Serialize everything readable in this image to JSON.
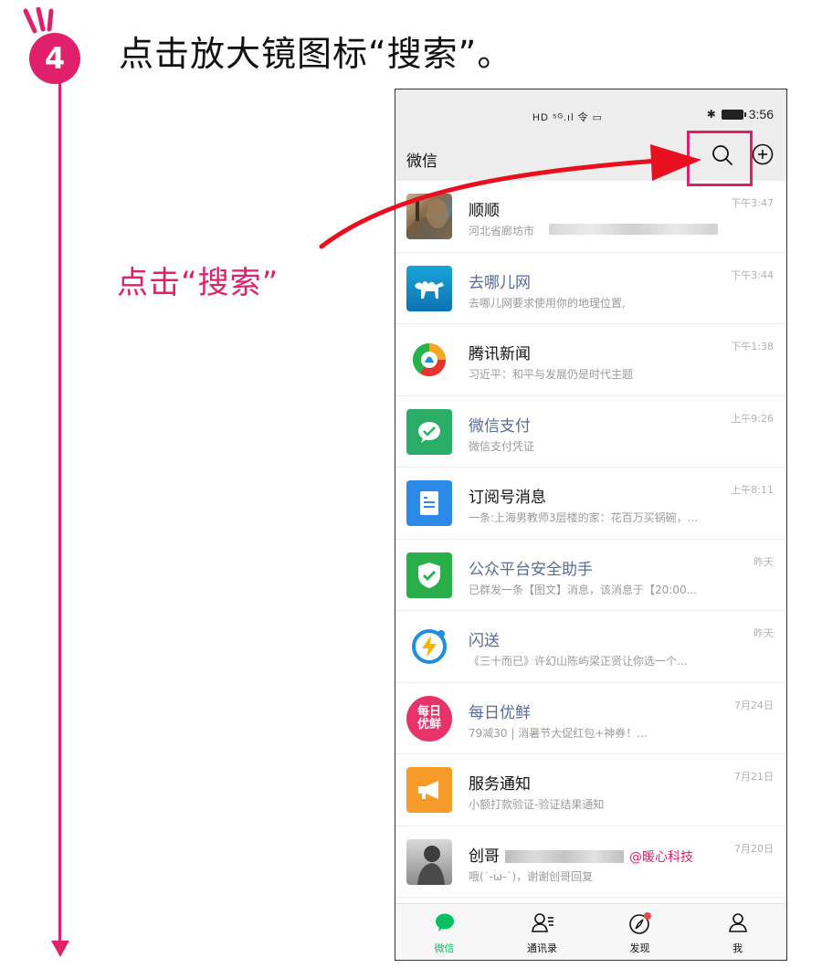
{
  "step": {
    "number": "4",
    "title": "点击放大镜图标“搜索”。",
    "callout": "点击“搜索”"
  },
  "statusbar": {
    "indicators": "HD ⁵ᴳ.ıl 令 ▭",
    "bluetooth": "✱",
    "time": "3:56"
  },
  "appbar": {
    "title": "微信",
    "search_icon": "search-icon",
    "add_icon": "plus-circle-icon"
  },
  "chats": [
    {
      "name": "顺顺",
      "preview": "河北省廊坊市",
      "time": "下午3:47",
      "link": false,
      "avatar": "photo"
    },
    {
      "name": "去哪儿网",
      "preview": "去哪儿网要求使用你的地理位置,",
      "time": "下午3:44",
      "link": true,
      "avatar": "camel"
    },
    {
      "name": "腾讯新闻",
      "preview": "习近平：和平与发展仍是时代主题",
      "time": "下午1:38",
      "link": false,
      "avatar": "news"
    },
    {
      "name": "微信支付",
      "preview": "微信支付凭证",
      "time": "上午9:26",
      "link": true,
      "avatar": "pay"
    },
    {
      "name": "订阅号消息",
      "preview": "一条:上海男教师3层楼的家：花百万买锅碗，...",
      "time": "上午8:11",
      "link": false,
      "avatar": "doc"
    },
    {
      "name": "公众平台安全助手",
      "preview": "已群发一条【图文】消息，该消息于【20:00...",
      "time": "昨天",
      "link": true,
      "avatar": "shield"
    },
    {
      "name": "闪送",
      "preview": "《三十而已》许幻山陈屿梁正贤让你选一个...",
      "time": "昨天",
      "link": true,
      "avatar": "bolt"
    },
    {
      "name": "每日优鲜",
      "preview": "79减30 | 消暑节大促红包+神券！...",
      "time": "7月24日",
      "link": true,
      "avatar": "fresh",
      "avatar_text": "每日\n优鲜"
    },
    {
      "name": "服务通知",
      "preview": "小额打款验证-验证结果通知",
      "time": "7月21日",
      "link": false,
      "avatar": "horn"
    },
    {
      "name": "创哥",
      "name_suffix": "@暖心科技",
      "preview": "哦(˙-ω-˙)，谢谢创哥回复",
      "time": "7月20日",
      "link": false,
      "avatar": "person"
    }
  ],
  "tabs": [
    {
      "label": "微信",
      "icon": "chat-bubble-icon",
      "active": true
    },
    {
      "label": "通讯录",
      "icon": "contacts-icon",
      "active": false
    },
    {
      "label": "发现",
      "icon": "compass-icon",
      "active": false
    },
    {
      "label": "我",
      "icon": "person-icon",
      "active": false
    }
  ],
  "colors": {
    "accent": "#e0206a",
    "wechat_green": "#07c160",
    "link_blue": "#576b95"
  }
}
